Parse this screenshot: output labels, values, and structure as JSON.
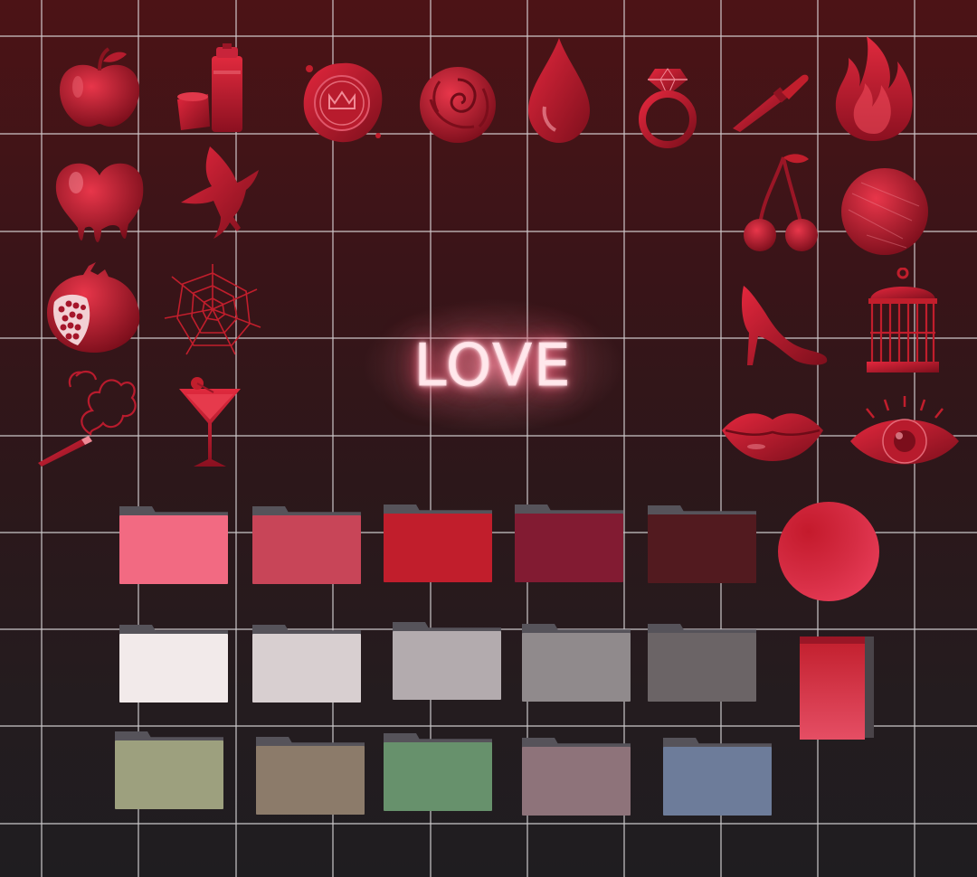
{
  "headline": {
    "text": "LOVE"
  },
  "icons": [
    "apple-icon",
    "spray-can-icon",
    "wax-seal-icon",
    "rose-icon",
    "blood-drop-icon",
    "diamond-ring-icon",
    "knife-icon",
    "flame-icon",
    "melting-heart-icon",
    "bird-icon",
    "cherries-icon",
    "planet-icon",
    "pomegranate-icon",
    "spider-web-icon",
    "birdcage-icon",
    "high-heel-icon",
    "smoking-cigarette-icon",
    "cocktail-glass-icon",
    "lips-icon",
    "eye-icon",
    "red-sphere-icon",
    "red-book-icon"
  ],
  "folder_colors": {
    "row1": [
      "#f26a82",
      "#c84558",
      "#c11e2c",
      "#821b32",
      "#521a1f"
    ],
    "row2": [
      "#f2eaea",
      "#d8cfd0",
      "#b3abae",
      "#908a8c",
      "#6b6466"
    ],
    "row3": [
      "#9da07e",
      "#8c7b6a",
      "#67916c",
      "#8e737a",
      "#6d7c9a"
    ]
  },
  "colors": {
    "accent": "#c11e2c",
    "grid_line": "#e8e6e8",
    "background_top": "#4c1316",
    "background_bottom": "#1f1d20"
  }
}
